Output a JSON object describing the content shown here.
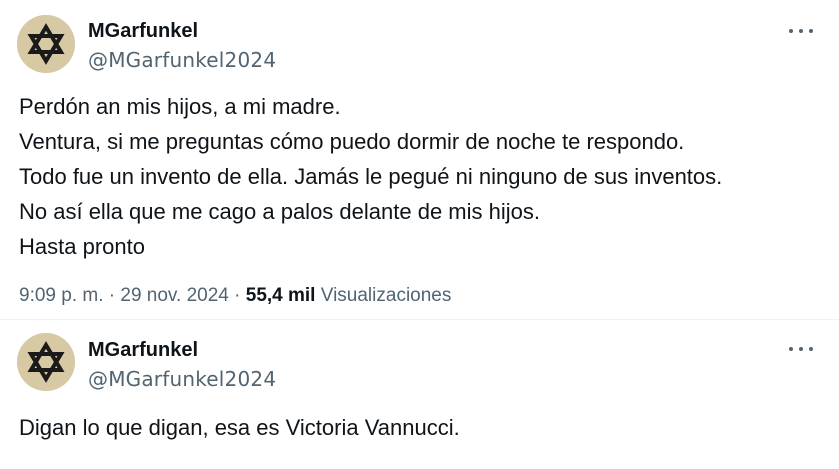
{
  "tweets": [
    {
      "author": {
        "name": "MGarfunkel",
        "handle": "@MGarfunkel2024",
        "avatar_icon": "star-of-david-icon"
      },
      "more_icon": "more-horizontal-icon",
      "lines": [
        "Perdón an mis hijos, a mi madre.",
        "Ventura, si me preguntas cómo puedo dormir de noche te respondo.",
        "Todo fue un invento de ella. Jamás le pegué ni ninguno de sus inventos.",
        "No así ella que me cago a palos delante de mis hijos.",
        "Hasta pronto"
      ],
      "meta": {
        "time": "9:09 p. m.",
        "separator": "·",
        "date": "29 nov. 2024",
        "views_count": "55,4 mil",
        "views_label": "Visualizaciones"
      }
    },
    {
      "author": {
        "name": "MGarfunkel",
        "handle": "@MGarfunkel2024",
        "avatar_icon": "star-of-david-icon"
      },
      "more_icon": "more-horizontal-icon",
      "lines": [
        "Digan lo que digan, esa es Victoria Vannucci."
      ]
    }
  ],
  "colors": {
    "text": "#0f1419",
    "secondary": "#536471",
    "avatar_bg": "#d8c9a5",
    "star": "#1a1a1a"
  }
}
